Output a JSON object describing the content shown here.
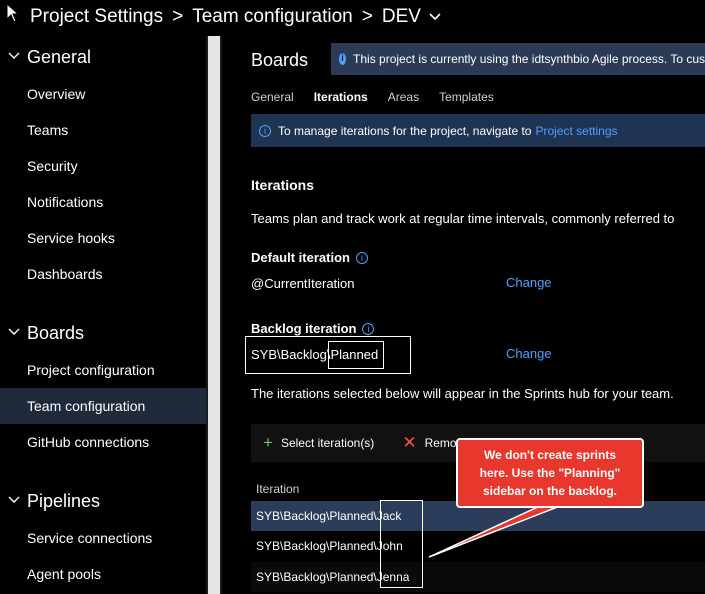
{
  "breadcrumb": {
    "project": "Project Settings",
    "section": "Team configuration",
    "team": "DEV"
  },
  "sidebar": {
    "groups": [
      {
        "label": "General",
        "items": [
          "Overview",
          "Teams",
          "Security",
          "Notifications",
          "Service hooks",
          "Dashboards"
        ]
      },
      {
        "label": "Boards",
        "items": [
          "Project configuration",
          "Team configuration",
          "GitHub connections"
        ]
      },
      {
        "label": "Pipelines",
        "items": [
          "Service connections",
          "Agent pools"
        ]
      }
    ],
    "active_item": "Team configuration"
  },
  "main": {
    "title": "Boards",
    "top_banner": "This project is currently using the idtsynthbio Agile process. To cus",
    "tabs": [
      "General",
      "Iterations",
      "Areas",
      "Templates"
    ],
    "active_tab": "Iterations",
    "manage_banner": {
      "text": "To manage iterations for the project, navigate to",
      "link": "Project settings"
    },
    "iterations_title": "Iterations",
    "iterations_desc": "Teams plan and track work at regular time intervals, commonly referred to",
    "default_iteration": {
      "title": "Default iteration",
      "value": "@CurrentIteration",
      "change": "Change"
    },
    "backlog_iteration": {
      "title": "Backlog iteration",
      "value_prefix": "SYB\\Backlog\\",
      "value_suffix": "Planned",
      "change": "Change"
    },
    "note": "The iterations selected below will appear in the Sprints hub for your team.",
    "toolbar": {
      "select": "Select iteration(s)",
      "remove": "Remove"
    },
    "table": {
      "column": "Iteration",
      "rows": [
        {
          "prefix": "SYB\\Backlog\\Planned\\",
          "name": "Jack"
        },
        {
          "prefix": "SYB\\Backlog\\Planned\\",
          "name": "John"
        },
        {
          "prefix": "SYB\\Backlog\\Planned\\",
          "name": "Jenna"
        }
      ]
    }
  },
  "callout": {
    "line1": "We don't create sprints",
    "line2": "here. Use the \"Planning\"",
    "line3": "sidebar on the backlog."
  },
  "colors": {
    "accent_link": "#4aa3ff",
    "selected_row": "#2b3d5a",
    "callout_red": "#e8372c",
    "banner_bg": "#1f3352"
  },
  "icons": [
    "cursor-icon",
    "chevron-down-icon",
    "info-icon",
    "plus-icon",
    "close-icon"
  ]
}
